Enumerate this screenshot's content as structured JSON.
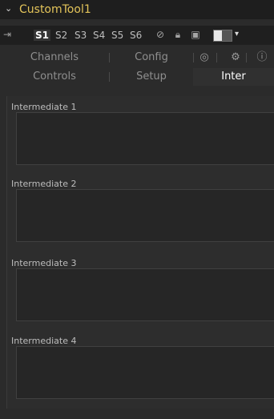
{
  "tool": {
    "title": "CustomTool1",
    "collapse_icon": "chevron-down-icon"
  },
  "toolbar": {
    "slots": [
      "S1",
      "S2",
      "S3",
      "S4",
      "S5",
      "S6"
    ],
    "active_slot": "S1",
    "icons": [
      "pin-icon",
      "disable-icon",
      "lock-icon",
      "cache-icon",
      "color-swatch",
      "dropdown-arrow-icon"
    ]
  },
  "tabs": {
    "row1": [
      {
        "label": "Channels"
      },
      {
        "label": "Config"
      }
    ],
    "row1_icons": [
      "nodes-icon",
      "gear-icon",
      "info-icon"
    ],
    "row2": [
      {
        "label": "Controls"
      },
      {
        "label": "Setup"
      },
      {
        "label": "Inter"
      }
    ],
    "selected": "Inter"
  },
  "intermediates": [
    {
      "label": "Intermediate 1",
      "value": ""
    },
    {
      "label": "Intermediate 2",
      "value": ""
    },
    {
      "label": "Intermediate 3",
      "value": ""
    },
    {
      "label": "Intermediate 4",
      "value": ""
    }
  ]
}
